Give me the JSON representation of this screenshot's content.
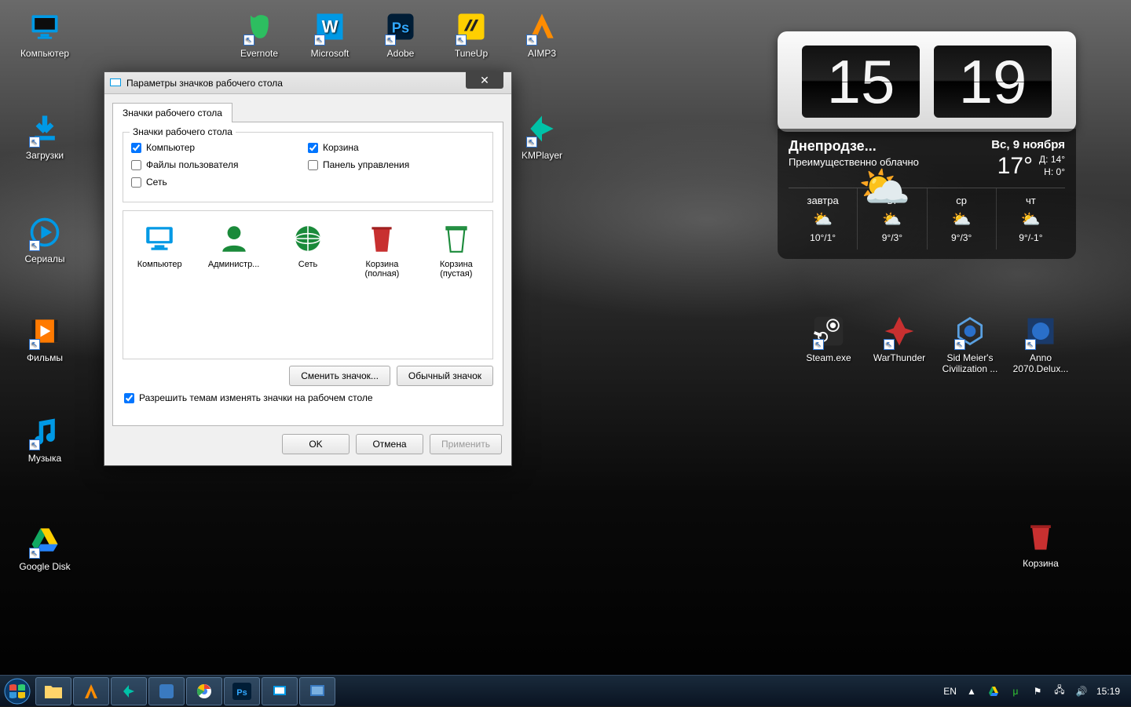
{
  "desktop_icons": {
    "computer": "Компьютер",
    "downloads": "Загрузки",
    "serials": "Сериалы",
    "films": "Фильмы",
    "music": "Музыка",
    "gdisk": "Google Disk",
    "evernote": "Evernote",
    "microsoft": "Microsoft",
    "adobe": "Adobe",
    "tuneup": "TuneUp",
    "aimp": "AIMP3",
    "kmplayer": "KMPlayer",
    "steam": "Steam.exe",
    "warthunder": "WarThunder",
    "civ": "Sid Meier's Civilization ...",
    "anno": "Anno 2070.Delux...",
    "bin": "Корзина"
  },
  "dialog": {
    "title": "Параметры значков рабочего стола",
    "tab": "Значки рабочего стола",
    "group_label": "Значки рабочего стола",
    "checks": {
      "computer": "Компьютер",
      "recycle": "Корзина",
      "userfiles": "Файлы пользователя",
      "cpanel": "Панель управления",
      "network": "Сеть"
    },
    "icons": {
      "computer": "Компьютер",
      "admin": "Администр...",
      "network": "Сеть",
      "bin_full": "Корзина (полная)",
      "bin_empty": "Корзина (пустая)"
    },
    "btn_change": "Сменить значок...",
    "btn_default": "Обычный значок",
    "allow_themes": "Разрешить темам изменять значки на рабочем столе",
    "ok": "OK",
    "cancel": "Отмена",
    "apply": "Применить"
  },
  "weather": {
    "hours": "15",
    "minutes": "19",
    "location": "Днепродзе...",
    "condition": "Преимущественно облачно",
    "date": "Вс, 9 ноября",
    "temp": "17°",
    "hi_label": "Д:",
    "hi": "14°",
    "lo_label": "Н:",
    "lo": "0°",
    "days": [
      {
        "name": "завтра",
        "temp": "10°/1°"
      },
      {
        "name": "вт",
        "temp": "9°/3°"
      },
      {
        "name": "ср",
        "temp": "9°/3°"
      },
      {
        "name": "чт",
        "temp": "9°/-1°"
      }
    ]
  },
  "taskbar": {
    "lang": "EN",
    "clock": "15:19"
  }
}
